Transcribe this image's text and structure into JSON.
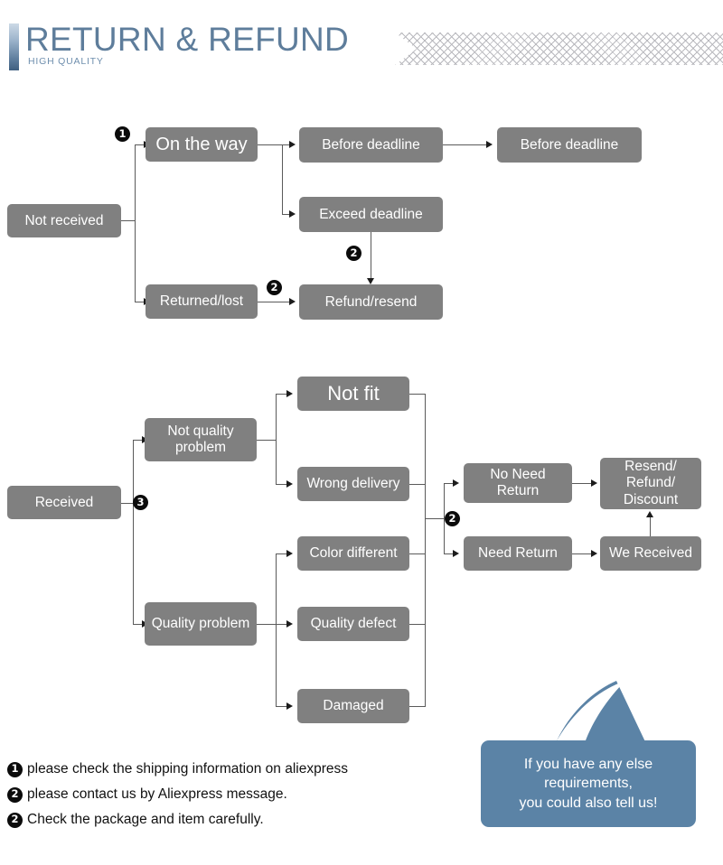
{
  "header": {
    "title": "RETURN & REFUND",
    "subtitle": "HIGH QUALITY",
    "accent_color": "#5e7d9b",
    "hatch_color": "#8e8e96"
  },
  "theme": {
    "box_fill": "#808080",
    "box_text": "#ffffff",
    "connector": "#5a5a5a",
    "badge_fill": "#0b0b0b",
    "bubble_fill": "#5b83a6"
  },
  "flow_not_received": {
    "root": "Not received",
    "branch_badge": "1",
    "on_the_way": "On the way",
    "before_deadline_1": "Before deadline",
    "before_deadline_2": "Before deadline",
    "exceed_deadline": "Exceed deadline",
    "exceed_badge": "2",
    "returned_lost": "Returned/lost",
    "returned_badge": "2",
    "refund_resend": "Refund/resend"
  },
  "flow_received": {
    "root": "Received",
    "branch_badge": "3",
    "not_quality_problem": "Not quality\nproblem",
    "quality_problem": "Quality problem",
    "not_fit": "Not fit",
    "wrong_delivery": "Wrong delivery",
    "color_different": "Color different",
    "quality_defect": "Quality defect",
    "damaged": "Damaged",
    "return_badge": "2",
    "no_need_return": "No Need\nReturn",
    "need_return": "Need Return",
    "we_received": "We Received",
    "resend_refund_discount": "Resend/\nRefund/\nDiscount"
  },
  "notes": [
    {
      "badge": "1",
      "text": "please check the shipping information on aliexpress"
    },
    {
      "badge": "2",
      "text": "please contact us by Aliexpress message."
    },
    {
      "badge": "2",
      "text": "Check the package and item carefully."
    }
  ],
  "bubble": {
    "text": "If you have any else\nrequirements,\nyou could also tell us!"
  }
}
